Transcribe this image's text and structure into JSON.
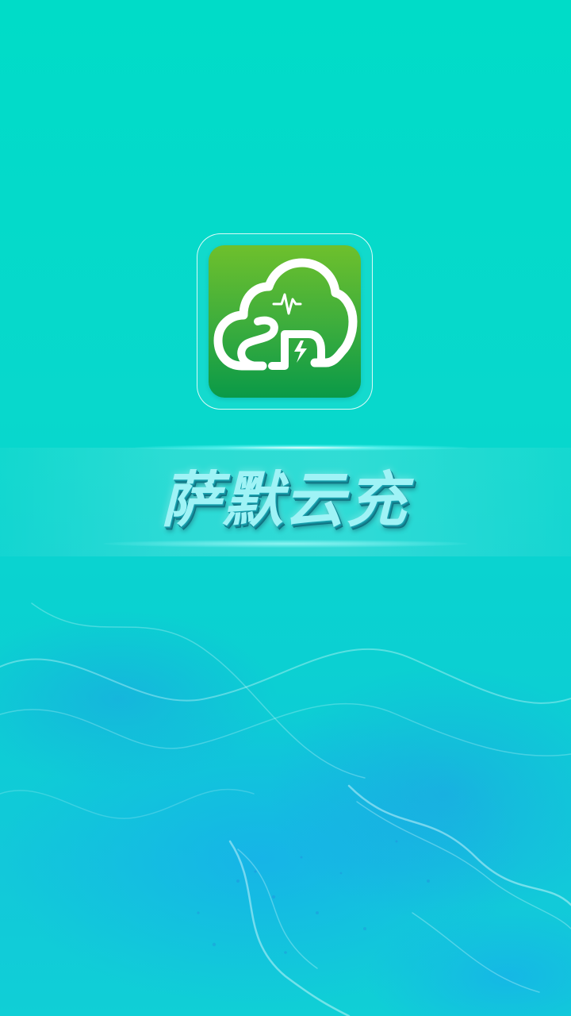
{
  "app": {
    "name": "萨默云充",
    "logo_icon": "cloud-charging-logo-icon",
    "brand_colors": {
      "background": "#00dcc8",
      "logo_green_top": "#6ec02c",
      "logo_green_bottom": "#0a9a48",
      "title_text": "#9ff3f6"
    }
  }
}
